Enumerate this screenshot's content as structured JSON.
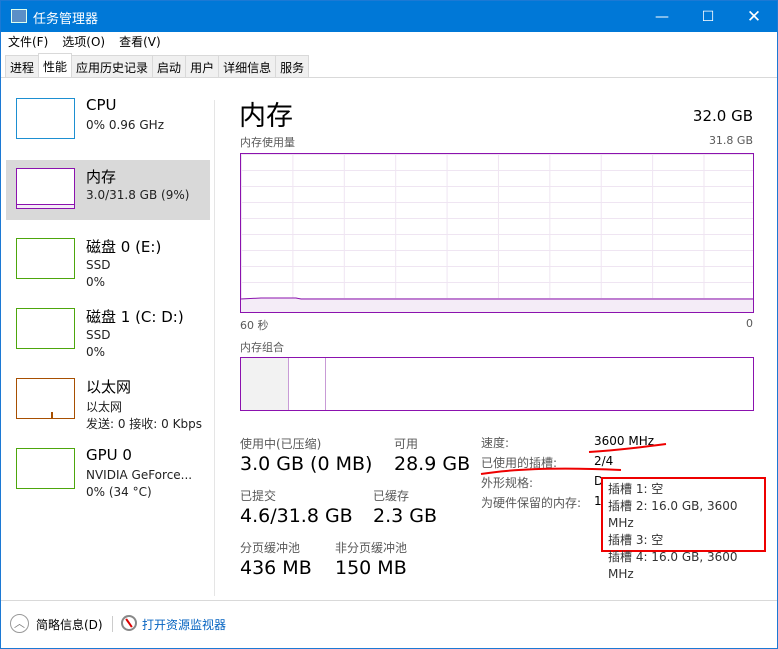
{
  "window": {
    "title": "任务管理器",
    "controls": [
      "minimize",
      "maximize",
      "close"
    ]
  },
  "menu": [
    "文件(F)",
    "选项(O)",
    "查看(V)"
  ],
  "tabs": [
    "进程",
    "性能",
    "应用历史记录",
    "启动",
    "用户",
    "详细信息",
    "服务"
  ],
  "active_tab": "性能",
  "sidebar": [
    {
      "title": "CPU",
      "lines": [
        "0% 0.96 GHz"
      ],
      "color": "#1d8fd1"
    },
    {
      "title": "内存",
      "lines": [
        "3.0/31.8 GB (9%)"
      ],
      "color": "#8b12ae",
      "selected": true
    },
    {
      "title": "磁盘 0 (E:)",
      "lines": [
        "SSD",
        "0%"
      ],
      "color": "#4da60c"
    },
    {
      "title": "磁盘 1 (C: D:)",
      "lines": [
        "SSD",
        "0%"
      ],
      "color": "#4da60c"
    },
    {
      "title": "以太网",
      "lines": [
        "以太网",
        "发送: 0 接收: 0 Kbps"
      ],
      "color": "#a74f01"
    },
    {
      "title": "GPU 0",
      "lines": [
        "NVIDIA GeForce...",
        "0% (34 °C)"
      ],
      "color": "#4da60c"
    }
  ],
  "main": {
    "title": "内存",
    "total": "32.0 GB",
    "usage_label": "内存使用量",
    "usage_max": "31.8 GB",
    "time_left": "60 秒",
    "time_right": "0",
    "composition_label": "内存组合",
    "accent": "#8b12ae",
    "in_use_fraction": 0.094,
    "stats": {
      "in_use_label": "使用中(已压缩)",
      "in_use": "3.0 GB (0 MB)",
      "available_label": "可用",
      "available": "28.9 GB",
      "committed_label": "已提交",
      "committed": "4.6/31.8 GB",
      "cached_label": "已缓存",
      "cached": "2.3 GB",
      "paged_label": "分页缓冲池",
      "paged": "436 MB",
      "nonpaged_label": "非分页缓冲池",
      "nonpaged": "150 MB"
    },
    "details": {
      "speed_label": "速度:",
      "speed": "3600 MHz",
      "slots_label": "已使用的插槽:",
      "slots": "2/4",
      "form_label": "外形规格:",
      "form": "D",
      "reserved_label": "为硬件保留的内存:",
      "reserved": "1"
    },
    "tooltip": [
      "插槽 1: 空",
      "插槽 2: 16.0 GB, 3600 MHz",
      "插槽 3: 空",
      "插槽 4: 16.0 GB, 3600 MHz"
    ]
  },
  "footer": {
    "fewer_details": "简略信息(D)",
    "resource_monitor": "打开资源监视器"
  }
}
